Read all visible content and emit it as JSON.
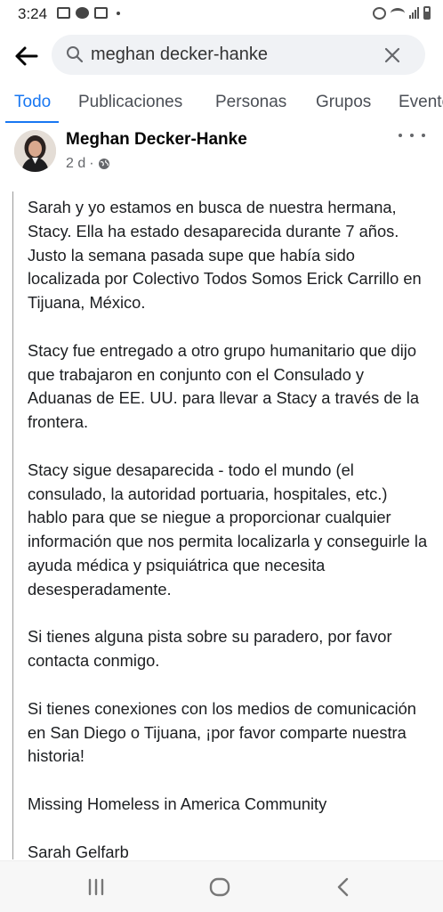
{
  "status_bar": {
    "time": "3:24"
  },
  "search": {
    "query": "meghan decker-hanke"
  },
  "tabs": [
    {
      "label": "Todo",
      "active": true
    },
    {
      "label": "Publicaciones",
      "active": false
    },
    {
      "label": "Personas",
      "active": false
    },
    {
      "label": "Grupos",
      "active": false
    },
    {
      "label": "Eventos",
      "active": false
    }
  ],
  "post": {
    "author": "Meghan Decker-Hanke",
    "time_ago": "2 d",
    "meta_separator": "·",
    "paragraphs": [
      "Sarah y yo estamos en busca de nuestra hermana, Stacy. Ella ha estado desaparecida durante 7 años. Justo la semana pasada supe que había sido localizada por Colectivo Todos Somos Erick Carrillo en Tijuana, México.",
      "Stacy fue entregado a otro grupo humanitario que dijo que trabajaron en conjunto con el Consulado y Aduanas de EE. UU. para llevar a Stacy a través de la frontera.",
      "Stacy sigue desaparecida - todo el mundo (el consulado, la autoridad portuaria, hospitales, etc.) hablo para que se niegue a proporcionar cualquier información que nos permita localizarla y conseguirle la ayuda médica y psiquiátrica que necesita desesperadamente.",
      "Si tienes alguna pista sobre su paradero, por favor contacta conmigo.",
      "Si tienes conexiones con los medios de comunicación en San Diego o Tijuana, ¡por favor comparte nuestra historia!",
      "Missing Homeless in America Community",
      "Sarah Gelfarb"
    ]
  },
  "colors": {
    "accent": "#1877f2",
    "text_primary": "#050505",
    "text_secondary": "#65676b",
    "search_bg": "#f0f2f5"
  },
  "icons": {
    "back": "arrow-left-icon",
    "search": "search-icon",
    "clear": "close-icon",
    "more": "more-dots-icon",
    "audience": "globe-icon",
    "nav_recents": "recents-icon",
    "nav_home": "home-icon",
    "nav_back": "back-chevron-icon"
  }
}
